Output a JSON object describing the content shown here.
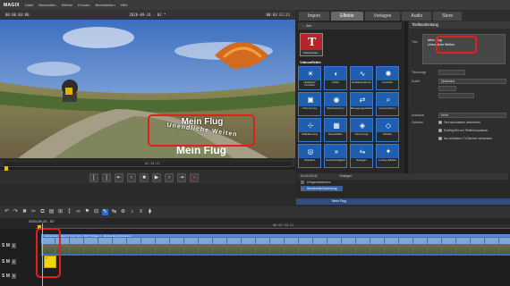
{
  "app": {
    "logo": "MAGIX",
    "menu": [
      "Datei",
      "Bearbeiten",
      "Effekte",
      "Fenster",
      "Bereitstellen",
      "Hilfe"
    ]
  },
  "preview": {
    "timecode_left": "00:00:03:00",
    "project_label": "2020-09-24 - 02 *",
    "timecode_right": "00:03:33:21",
    "title_line1": "Mein Flug",
    "title_line2": "Unendliche Weiten",
    "ruler_timecode": "02:33:21"
  },
  "tabs": [
    "Import",
    "Effekte",
    "Vorlagen",
    "Audio",
    "Store"
  ],
  "tabs_active": "Effekte",
  "effects": {
    "filter": "Alle",
    "title_tile_label": "Titelbearbeit...",
    "section": "Videoeffekte",
    "items": [
      {
        "label": "Helligkeit/ Kontrast",
        "icon": "☀"
      },
      {
        "label": "Farbe",
        "icon": "◐"
      },
      {
        "label": "Gradationskurve",
        "icon": "∿"
      },
      {
        "label": "Leuchten",
        "icon": "✺"
      },
      {
        "label": "Chroma Key",
        "icon": "▣"
      },
      {
        "label": "Weichzeichner",
        "icon": "◉"
      },
      {
        "label": "Bewegungseffekte",
        "icon": "⇄"
      },
      {
        "label": "Kamera/Zoom",
        "icon": "⌕"
      },
      {
        "label": "Stabilisierung",
        "icon": "⊹"
      },
      {
        "label": "Rauschfilter",
        "icon": "▦"
      },
      {
        "label": "Verzerrung",
        "icon": "◈"
      },
      {
        "label": "Schärfe",
        "icon": "◇"
      },
      {
        "label": "Objektive",
        "icon": "◎"
      },
      {
        "label": "Geschwindigkeit",
        "icon": "»"
      },
      {
        "label": "Spiegeln",
        "icon": "⇋"
      },
      {
        "label": "Lookup-Effekte",
        "icon": "✦"
      }
    ]
  },
  "title_editor": {
    "header": "Titelbearbeitung",
    "text_label": "Titel",
    "line1": "Mein Flug",
    "line2": "Unendliche Weiten",
    "preset_label": "Titelvorlage",
    "font_label": "Schrift",
    "font_value": "Quicksand",
    "animation_label": "Animation",
    "animation_value": "Keine",
    "options_label": "Optionen",
    "opt1": "Text automatisch umbrechen",
    "opt2": "Schriftgröße am Titelfeld anpassen",
    "opt3": "Nur sichtbaren TV-Bereich verwenden"
  },
  "clip_info": {
    "head1": "00:00:03:00",
    "head2": "Einfügen",
    "row1": "Klingendfarbenen",
    "row2": "Bandbreite/Anbindung",
    "title": "Mein Flug"
  },
  "timeline": {
    "project": "2020-09-24 - 02",
    "ruler_timecode": "00:02:33:21",
    "clip_label": "Einblenden Video FX (v1).mp4 - 360° Vorlage 1 - Einblendung Standard...",
    "title_clip_label": "T",
    "tracks": [
      {
        "num": "1",
        "flags": "S M"
      },
      {
        "num": "2",
        "flags": "S M"
      },
      {
        "num": "3",
        "flags": "S M"
      }
    ]
  }
}
